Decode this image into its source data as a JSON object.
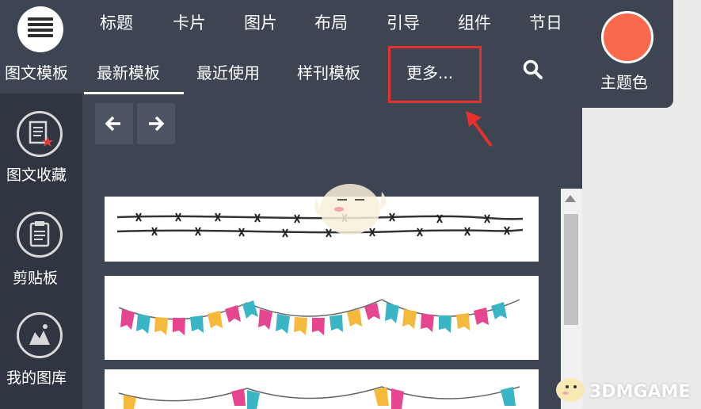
{
  "app": {
    "logo_label": "图文模板",
    "theme_label": "主题色",
    "theme_color": "#fc6a4e"
  },
  "topnav": {
    "items": [
      "标题",
      "卡片",
      "图片",
      "布局",
      "引导",
      "组件",
      "节日"
    ]
  },
  "subnav": {
    "items": [
      "最新模板",
      "最近使用",
      "样刊模板",
      "更多..."
    ],
    "active_index": 0
  },
  "sidebar": {
    "items": [
      {
        "label": "图文收藏",
        "icon": "document-star-icon"
      },
      {
        "label": "剪贴板",
        "icon": "clipboard-icon"
      },
      {
        "label": "我的图库",
        "icon": "image-gallery-icon"
      }
    ]
  },
  "content": {
    "banners": [
      "barbed-wire-divider",
      "pennant-bunting",
      "pennant-bunting"
    ]
  },
  "watermark": {
    "text": "3DMGAME"
  },
  "annotation_color": "#e5302d"
}
